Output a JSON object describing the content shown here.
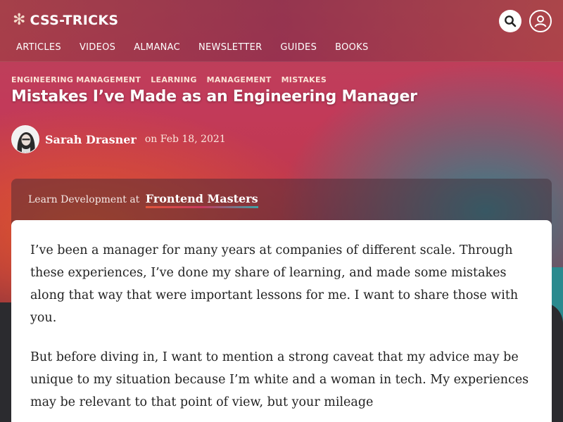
{
  "header": {
    "logo_text": "CSS-TRICKS",
    "nav": [
      "ARTICLES",
      "VIDEOS",
      "ALMANAC",
      "NEWSLETTER",
      "GUIDES",
      "BOOKS"
    ]
  },
  "article": {
    "tags": [
      "ENGINEERING MANAGEMENT",
      "LEARNING",
      "MANAGEMENT",
      "MISTAKES"
    ],
    "title": "Mistakes I’ve Made as an Engineering Manager",
    "author": "Sarah Drasner",
    "date_prefix": "on",
    "date": "Feb 18, 2021",
    "paragraphs": [
      "I’ve been a manager for many years at companies of different scale. Through these experiences, I’ve done my share of learning, and made some mistakes along that way that were important lessons for me. I want to share those with you.",
      "But before diving in, I want to mention a strong caveat that my advice may be unique to my situation because I’m white and a woman in tech. My experiences may be relevant to that point of view, but your mileage"
    ]
  },
  "promo": {
    "text": "Learn Development at",
    "link": "Frontend Masters"
  },
  "icons": {
    "logo": "asterisk-icon",
    "search": "search-icon",
    "account": "user-icon"
  },
  "colors": {
    "accent_orange": "#e2573a",
    "accent_magenta": "#c9385e",
    "accent_teal": "#3aa3a8"
  }
}
